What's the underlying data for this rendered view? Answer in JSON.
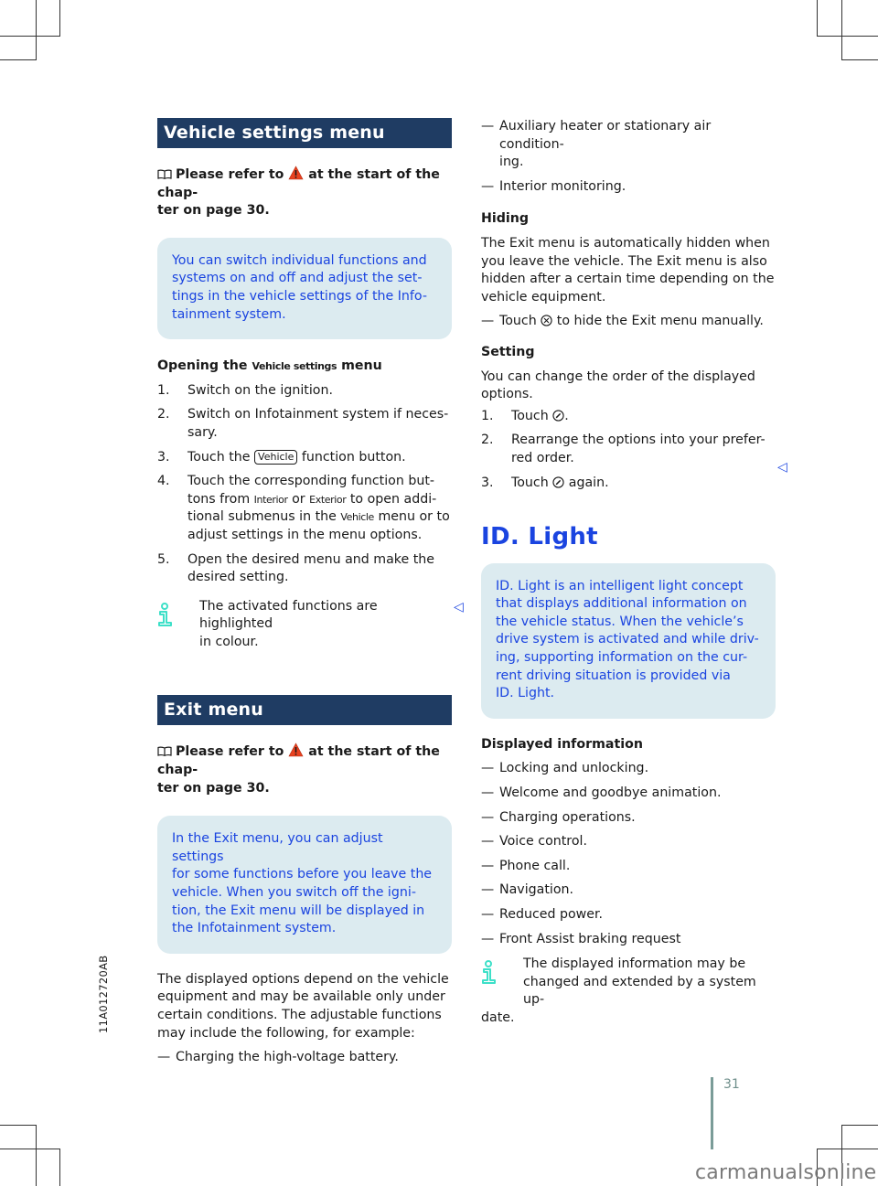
{
  "left": {
    "vehicle_settings": {
      "heading": "Vehicle settings menu",
      "ref_pre": "Please refer to",
      "ref_post": "at the start of the chap-",
      "ref_line2": "ter on page 30.",
      "info_lines": [
        "You can switch individual functions and",
        "systems on and off and adjust the set-",
        "tings in the vehicle settings of the Info-",
        "tainment system."
      ],
      "opening_pre": "Opening the",
      "opening_term": "Vehicle settings",
      "opening_post": "menu",
      "steps": [
        {
          "num": "1.",
          "text": "Switch on the ignition."
        },
        {
          "num": "2.",
          "text_lines": [
            "Switch on Infotainment system if neces-",
            "sary."
          ]
        },
        {
          "num": "3.",
          "pre": "Touch the",
          "button": "Vehicle",
          "post": "function button."
        },
        {
          "num": "4.",
          "l1": "Touch the corresponding function but-",
          "l2_pre": "tons from",
          "term_a": "Interior",
          "or": "or",
          "term_b": "Exterior",
          "l2_post": "to open addi-",
          "l3_pre": "tional submenus in the",
          "term_c": "Vehicle",
          "l3_post": "menu or to",
          "l4": "adjust settings in the menu options."
        },
        {
          "num": "5.",
          "text_lines": [
            "Open the desired menu and make the",
            "desired setting."
          ]
        }
      ],
      "note_lines": [
        "The activated functions are highlighted",
        "in colour."
      ]
    },
    "exit_menu": {
      "heading": "Exit menu",
      "ref_pre": "Please refer to",
      "ref_post": "at the start of the chap-",
      "ref_line2": "ter on page 30.",
      "info_lines": [
        "In the Exit menu, you can adjust settings",
        "for some functions before you leave the",
        "vehicle. When you switch off the igni-",
        "tion, the Exit menu will be displayed in",
        "the Infotainment system."
      ],
      "body_lines": [
        "The displayed options depend on the vehicle",
        "equipment and may be available only under",
        "certain conditions. The adjustable functions",
        "may include the following, for example:"
      ],
      "bullets": [
        "Charging the high-voltage battery."
      ]
    }
  },
  "right": {
    "exit_bullets_cont": [
      [
        "Auxiliary heater or stationary air condition-",
        "ing."
      ],
      [
        "Interior monitoring."
      ]
    ],
    "hiding": {
      "heading": "Hiding",
      "body_lines": [
        "The Exit menu is automatically hidden when",
        "you leave the vehicle. The Exit menu is also",
        "hidden after a certain time depending on the",
        "vehicle equipment."
      ],
      "bullet_pre": "Touch",
      "bullet_post": "to hide the Exit menu manually."
    },
    "setting": {
      "heading": "Setting",
      "body_lines": [
        "You can change the order of the displayed",
        "options."
      ],
      "steps": [
        {
          "num": "1.",
          "pre": "Touch",
          "post": "."
        },
        {
          "num": "2.",
          "text_lines": [
            "Rearrange the options into your prefer-",
            "red order."
          ]
        },
        {
          "num": "3.",
          "pre": "Touch",
          "post": "again."
        }
      ]
    },
    "id_light": {
      "title": "ID. Light",
      "info_lines": [
        "ID. Light is an intelligent light concept",
        "that displays additional information on",
        "the vehicle status. When the vehicle’s",
        "drive system is activated and while driv-",
        "ing, supporting information on the cur-",
        "rent driving situation is provided via",
        "ID. Light."
      ],
      "displayed_heading": "Displayed information",
      "bullets": [
        "Locking and unlocking.",
        "Welcome and goodbye animation.",
        "Charging operations.",
        "Voice control.",
        "Phone call.",
        "Navigation.",
        "Reduced power.",
        "Front Assist braking request"
      ],
      "note_line1": "The displayed information may be",
      "note_line2": "changed and extended by a system up-",
      "note_line3": "date."
    }
  },
  "icons": {
    "book": "book-icon",
    "warning": "warning-triangle-icon",
    "info": "info-icon",
    "close_circle": "close-circle-icon",
    "edit_circle": "edit-circle-icon",
    "end_of_section": "◁"
  },
  "colors": {
    "section_heading_bg": "#1f3c63",
    "accent_blue": "#1a44e0",
    "infobox_bg": "#dcebf0",
    "info_icon": "#3de0c8",
    "warning": "#e8411f"
  },
  "footer": {
    "side_code": "11A012720AB",
    "page_number": "31",
    "watermark": "carmanualsonline.info"
  },
  "dash": "—"
}
